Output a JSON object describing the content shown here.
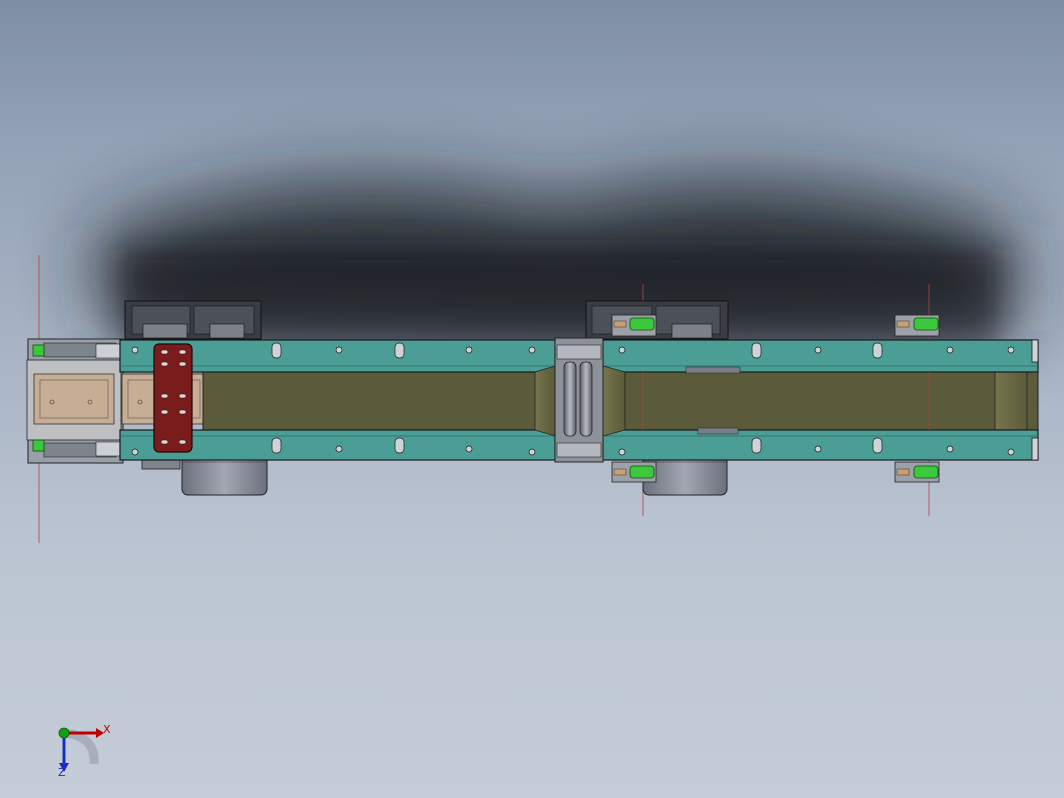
{
  "app": {
    "view": "Top",
    "background_top": "#7e8ea4",
    "background_bottom": "#c4ccd8"
  },
  "model": {
    "frame_color": "#4a9e96",
    "belt_color": "#5b5a3a",
    "bracket_color": "#7a1c1c",
    "sensor_color": "#3cc83c",
    "motor_color": "#8a8e9c",
    "shadow_color": "#1e2127"
  },
  "triad": {
    "x_label": "X",
    "z_label": "Z",
    "x_color": "#c00000",
    "y_color": "#10a010",
    "z_color": "#1a2fc0"
  }
}
